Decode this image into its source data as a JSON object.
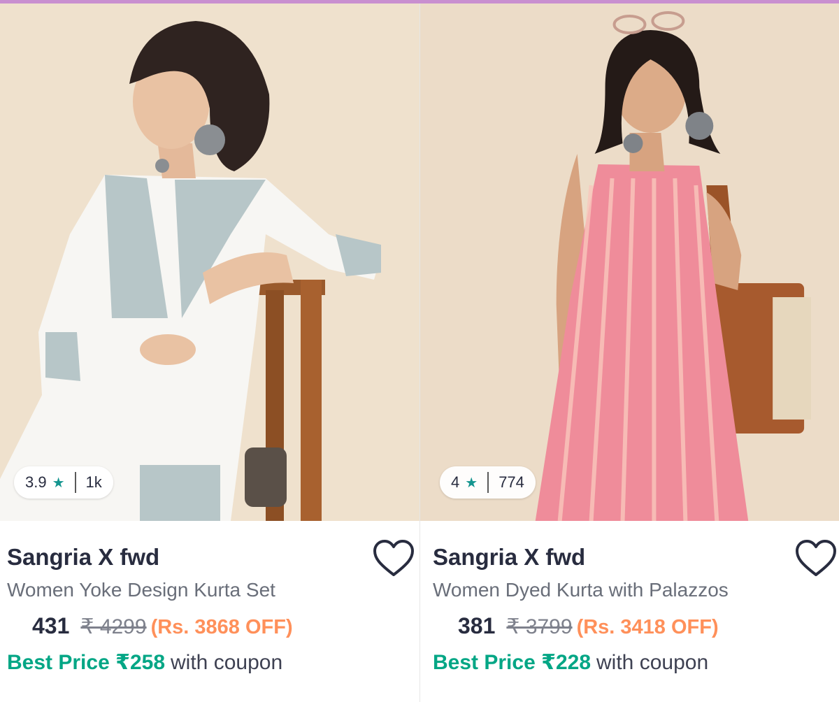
{
  "colors": {
    "accent_strip": "#c98fd0",
    "rating_star": "#14958f",
    "discount": "#ff905a",
    "best_price": "#03a685"
  },
  "products": [
    {
      "rating": "3.9",
      "rating_icon": "star-icon",
      "reviews": "1k",
      "brand": "Sangria X fwd",
      "title": "Women Yoke Design Kurta Set",
      "price": "431",
      "mrp": "₹ 4299",
      "discount": "(Rs. 3868 OFF)",
      "best_price": "Best Price ₹258",
      "coupon_suffix": "with coupon",
      "wishlist_icon": "heart-outline-icon"
    },
    {
      "rating": "4",
      "rating_icon": "star-icon",
      "reviews": "774",
      "brand": "Sangria X fwd",
      "title": "Women Dyed Kurta with Palazzos",
      "price": "381",
      "mrp": "₹ 3799",
      "discount": "(Rs. 3418 OFF)",
      "best_price": "Best Price ₹228",
      "coupon_suffix": "with coupon",
      "wishlist_icon": "heart-outline-icon"
    }
  ]
}
